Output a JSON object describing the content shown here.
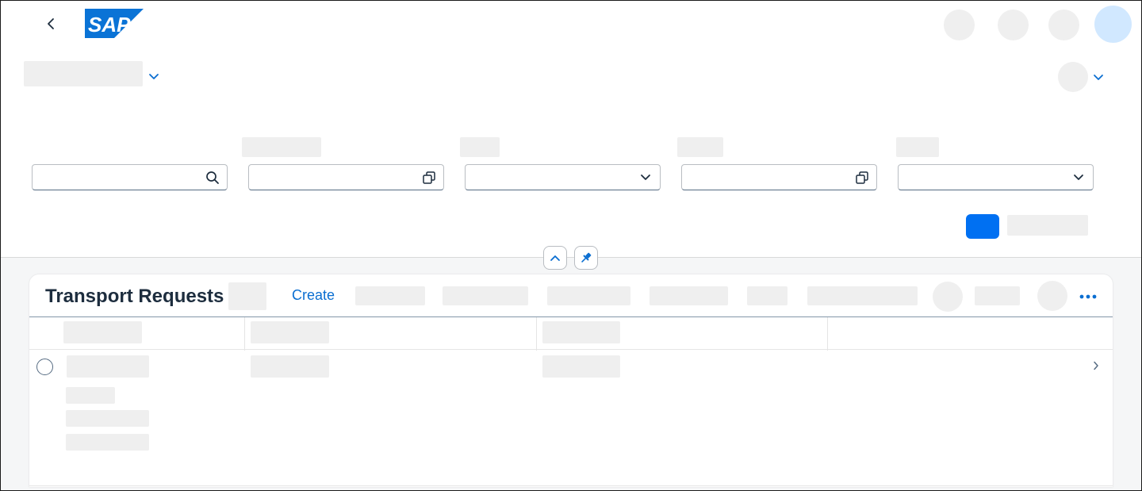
{
  "shell": {
    "logo_text": "SAP",
    "brand_color": "#0070f2",
    "icons": [
      "chevron-left-icon",
      "chevron-down-icon"
    ]
  },
  "filterbar": {
    "search_icon": "search-icon",
    "value_help_icon": "value-help-icon",
    "dropdown_icon": "chevron-down-icon",
    "collapse_icon": "chevron-up-icon",
    "pin_icon": "pin-icon",
    "fields": [
      {
        "type": "search",
        "value": "",
        "placeholder": ""
      },
      {
        "type": "value-help",
        "value": "",
        "placeholder": ""
      },
      {
        "type": "select",
        "value": "",
        "placeholder": ""
      },
      {
        "type": "value-help",
        "value": "",
        "placeholder": ""
      },
      {
        "type": "select",
        "value": "",
        "placeholder": ""
      }
    ]
  },
  "table": {
    "title": "Transport Requests",
    "create_label": "Create",
    "more_icon": "overflow-icon",
    "row_nav_icon": "chevron-right-icon"
  },
  "colors": {
    "accent": "#0070f2",
    "link": "#0a6ed1",
    "avatar": "#d1e8ff",
    "skeleton": "#efefef"
  }
}
